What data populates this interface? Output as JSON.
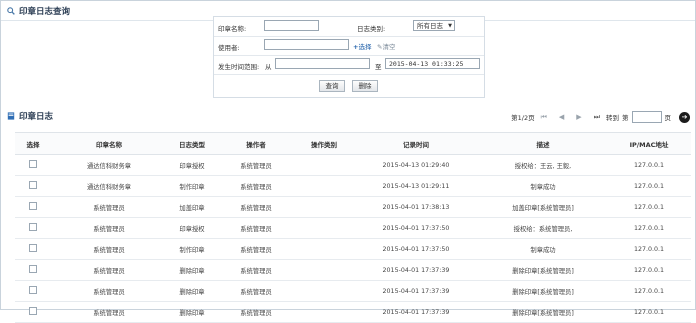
{
  "query": {
    "title": "印章日志查询",
    "seal_name_label": "印章名称:",
    "seal_name_value": "",
    "log_type_label": "日志类别:",
    "log_type_value": "所有日志",
    "user_label": "使用者:",
    "user_value": "",
    "select_link": "选择",
    "clear_link": "清空",
    "time_label": "发生时间范围:",
    "from_label": "从",
    "from_value": "",
    "to_label": "至",
    "to_value": "2015-04-13 01:33:25",
    "search_button": "查询",
    "delete_button": "删除"
  },
  "log": {
    "title": "印章日志",
    "pager": {
      "page_info": "第1/2页",
      "goto_label": "转到",
      "page_prefix": "第",
      "page_suffix": "页",
      "goto_value": ""
    },
    "columns": [
      "选择",
      "印章名称",
      "日志类型",
      "操作者",
      "操作类别",
      "记录时间",
      "描述",
      "IP/MAC地址"
    ],
    "rows": [
      {
        "seal": "通达信科财务章",
        "type": "印章授权",
        "operator": "系统管理员",
        "category": "",
        "time": "2015-04-13 01:29:40",
        "desc": "授权给：王云, 王毅,",
        "ip": "127.0.0.1"
      },
      {
        "seal": "通达信科财务章",
        "type": "制作印章",
        "operator": "系统管理员",
        "category": "",
        "time": "2015-04-13 01:29:11",
        "desc": "制章成功",
        "ip": "127.0.0.1"
      },
      {
        "seal": "系统管理员",
        "type": "加盖印章",
        "operator": "系统管理员",
        "category": "",
        "time": "2015-04-01 17:38:13",
        "desc": "加盖印章[系统管理员]",
        "ip": "127.0.0.1"
      },
      {
        "seal": "系统管理员",
        "type": "印章授权",
        "operator": "系统管理员",
        "category": "",
        "time": "2015-04-01 17:37:50",
        "desc": "授权给：系统管理员,",
        "ip": "127.0.0.1"
      },
      {
        "seal": "系统管理员",
        "type": "制作印章",
        "operator": "系统管理员",
        "category": "",
        "time": "2015-04-01 17:37:50",
        "desc": "制章成功",
        "ip": "127.0.0.1"
      },
      {
        "seal": "系统管理员",
        "type": "删除印章",
        "operator": "系统管理员",
        "category": "",
        "time": "2015-04-01 17:37:39",
        "desc": "删除印章[系统管理员]",
        "ip": "127.0.0.1"
      },
      {
        "seal": "系统管理员",
        "type": "删除印章",
        "operator": "系统管理员",
        "category": "",
        "time": "2015-04-01 17:37:39",
        "desc": "删除印章[系统管理员]",
        "ip": "127.0.0.1"
      },
      {
        "seal": "系统管理员",
        "type": "删除印章",
        "operator": "系统管理员",
        "category": "",
        "time": "2015-04-01 17:37:39",
        "desc": "删除印章[系统管理员]",
        "ip": "127.0.0.1"
      }
    ]
  }
}
